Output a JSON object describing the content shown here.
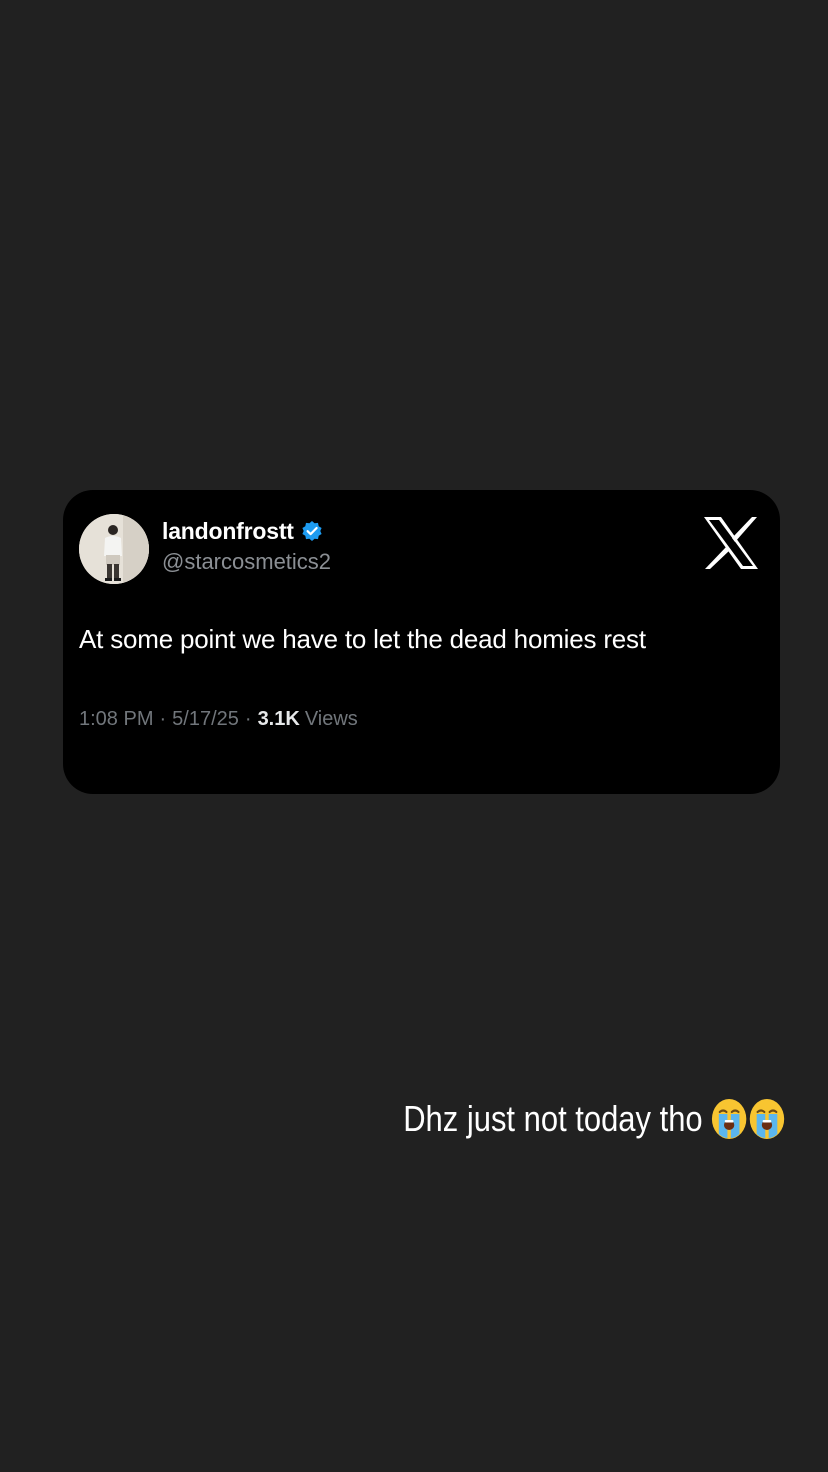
{
  "tweet": {
    "display_name": "landonfrostt",
    "verified": true,
    "handle": "@starcosmetics2",
    "text": "At some point we have to let the dead homies rest",
    "time": "1:08 PM",
    "separator": "·",
    "date": "5/17/25",
    "views_count": "3.1K",
    "views_label": "Views",
    "platform_icon": "x-logo-icon",
    "avatar_icon": "profile-avatar"
  },
  "caption": {
    "text": "Dhz just not today tho",
    "emojis": [
      "loudly-crying-face-icon",
      "loudly-crying-face-icon"
    ]
  },
  "colors": {
    "background": "#212121",
    "card": "#000000",
    "verified_blue": "#1d9bf0",
    "secondary_text": "#71767b",
    "handle_text": "#8b8f94",
    "emoji_yellow": "#f8c531",
    "tears_blue": "#5bb6ee"
  }
}
